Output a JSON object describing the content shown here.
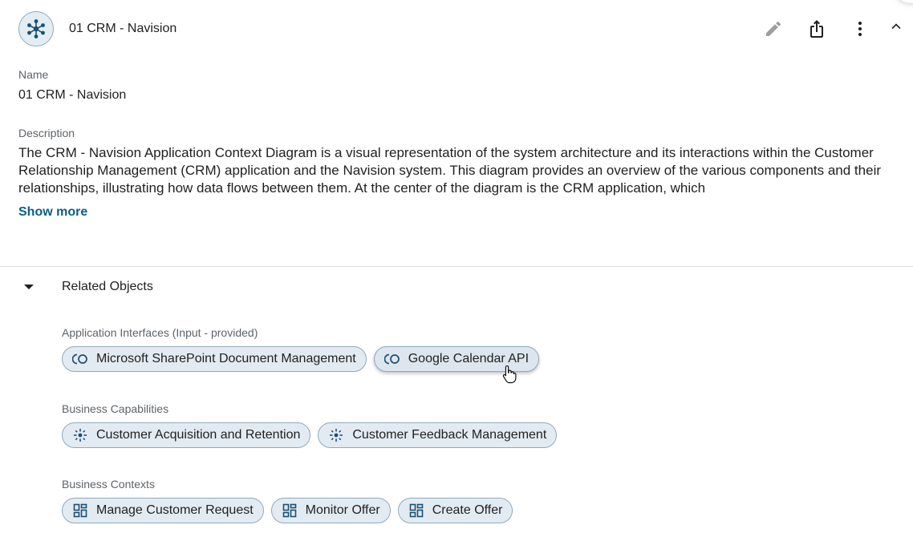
{
  "header": {
    "title": "01 CRM - Navision",
    "icon": "network-diagram-icon"
  },
  "fields": {
    "name_label": "Name",
    "name_value": "01 CRM - Navision",
    "description_label": "Description",
    "description_value": "The CRM - Navision Application Context Diagram is a visual representation of the system architecture and its interactions within the Customer Relationship Management (CRM) application and the Navision system. This diagram provides an overview of the various components and their relationships, illustrating how data flows between them. At the center of the diagram is the CRM application, which",
    "show_more": "Show more"
  },
  "related": {
    "title": "Related Objects",
    "groups": [
      {
        "label": "Application Interfaces (Input - provided)",
        "icon": "interface-icon",
        "items": [
          "Microsoft SharePoint Document Management",
          "Google Calendar API"
        ]
      },
      {
        "label": "Business Capabilities",
        "icon": "capability-icon",
        "items": [
          "Customer Acquisition and Retention",
          "Customer Feedback Management"
        ]
      },
      {
        "label": "Business Contexts",
        "icon": "dashboard-icon",
        "items": [
          "Manage Customer Request",
          "Monitor Offer",
          "Create Offer"
        ]
      }
    ]
  },
  "colors": {
    "accent": "#0b5d8a",
    "chip_bg": "#e3ebf2",
    "chip_border": "#8fa9bd",
    "icon": "#1b4f72"
  }
}
